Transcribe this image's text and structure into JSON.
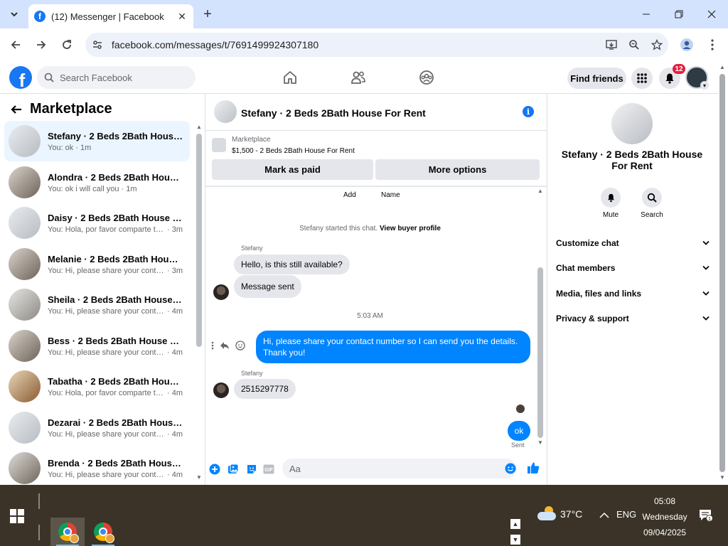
{
  "browser": {
    "tab_title": "(12) Messenger | Facebook",
    "url": "facebook.com/messages/t/7691499924307180"
  },
  "fb": {
    "search_placeholder": "Search Facebook",
    "find_friends": "Find friends",
    "notification_count": "12"
  },
  "left": {
    "title": "Marketplace",
    "conversations": [
      {
        "name": "Stefany · 2 Beds 2Bath House F...",
        "snippet": "You: ok",
        "time": "· 1m",
        "active": true
      },
      {
        "name": "Alondra · 2 Beds 2Bath House F...",
        "snippet": "You: ok i will call you",
        "time": "· 1m"
      },
      {
        "name": "Daisy · 2 Beds 2Bath House For ...",
        "snippet": "You: Hola, por favor comparte tu ...",
        "time": "· 3m"
      },
      {
        "name": "Melanie · 2 Beds 2Bath House F...",
        "snippet": "You: Hi, please share your contact ...",
        "time": "· 3m"
      },
      {
        "name": "Sheila · 2 Beds 2Bath House For...",
        "snippet": "You: Hi, please share your contact ...",
        "time": "· 4m"
      },
      {
        "name": "Bess · 2 Beds 2Bath House For R...",
        "snippet": "You: Hi, please share your contact ...",
        "time": "· 4m"
      },
      {
        "name": "Tabatha · 2 Beds 2Bath House F...",
        "snippet": "You: Hola, por favor comparte tu ...",
        "time": "· 4m"
      },
      {
        "name": "Dezarai · 2 Beds 2Bath House F...",
        "snippet": "You: Hi, please share your contact ...",
        "time": "· 4m"
      },
      {
        "name": "Brenda · 2 Beds 2Bath House Fo...",
        "snippet": "You: Hi, please share your contact ...",
        "time": "· 4m"
      }
    ]
  },
  "chat": {
    "title": "Stefany · 2 Beds 2Bath House For Rent",
    "marketplace_label": "Marketplace",
    "listing": "$1,500 - 2 Beds 2Bath House For Rent",
    "mark_paid": "Mark as paid",
    "more_options": "More options",
    "add_label": "Add",
    "name_label": "Name",
    "started_text": "Stefany started this chat.",
    "view_profile": "View buyer profile",
    "sender1": "Stefany",
    "msg1": "Hello, is this still available?",
    "msg2": "Message sent",
    "timestamp": "5:03 AM",
    "msg3": "Hi, please share your contact number so I can send you the details. Thank you!",
    "sender2": "Stefany",
    "msg4": "2515297778",
    "msg5": "ok",
    "sent_label": "Sent",
    "composer_placeholder": "Aa"
  },
  "right": {
    "name": "Stefany · 2 Beds 2Bath House For Rent",
    "mute": "Mute",
    "search": "Search",
    "sections": [
      "Customize chat",
      "Chat members",
      "Media, files and links",
      "Privacy & support"
    ]
  },
  "taskbar": {
    "temp": "37°C",
    "lang": "ENG",
    "time": "05:08",
    "day": "Wednesday",
    "date": "09/04/2025",
    "notif_count": "1"
  }
}
